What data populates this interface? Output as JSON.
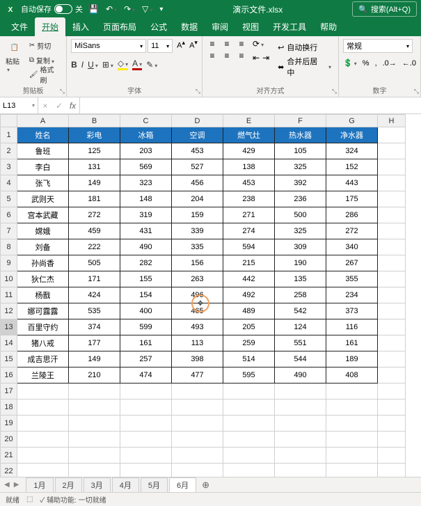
{
  "titlebar": {
    "autosave_label": "自动保存",
    "autosave_state": "关",
    "filename": "演示文件.xlsx",
    "search_placeholder": "搜索(Alt+Q)"
  },
  "tabs": {
    "items": [
      "文件",
      "开始",
      "插入",
      "页面布局",
      "公式",
      "数据",
      "审阅",
      "视图",
      "开发工具",
      "帮助"
    ],
    "active": "开始"
  },
  "ribbon": {
    "clipboard": {
      "paste": "粘贴",
      "cut": "剪切",
      "copy": "复制",
      "format_painter": "格式刷",
      "group_label": "剪贴板"
    },
    "font": {
      "name": "MiSans",
      "size": "11",
      "group_label": "字体"
    },
    "alignment": {
      "wrap": "自动换行",
      "merge": "合并后居中",
      "group_label": "对齐方式"
    },
    "number": {
      "format": "常规",
      "group_label": "数字"
    }
  },
  "namebox": {
    "cell": "L13"
  },
  "columns": [
    "A",
    "B",
    "C",
    "D",
    "E",
    "F",
    "G",
    "H"
  ],
  "header_row": [
    "姓名",
    "彩电",
    "冰箱",
    "空调",
    "燃气灶",
    "热水器",
    "净水器"
  ],
  "chart_data": {
    "type": "table",
    "title": "",
    "columns": [
      "姓名",
      "彩电",
      "冰箱",
      "空调",
      "燃气灶",
      "热水器",
      "净水器"
    ],
    "rows": [
      {
        "姓名": "鲁班",
        "彩电": 125,
        "冰箱": 203,
        "空调": 453,
        "燃气灶": 429,
        "热水器": 105,
        "净水器": 324
      },
      {
        "姓名": "李白",
        "彩电": 131,
        "冰箱": 569,
        "空调": 527,
        "燃气灶": 138,
        "热水器": 325,
        "净水器": 152
      },
      {
        "姓名": "张飞",
        "彩电": 149,
        "冰箱": 323,
        "空调": 456,
        "燃气灶": 453,
        "热水器": 392,
        "净水器": 443
      },
      {
        "姓名": "武则天",
        "彩电": 181,
        "冰箱": 148,
        "空调": 204,
        "燃气灶": 238,
        "热水器": 236,
        "净水器": 175
      },
      {
        "姓名": "宫本武藏",
        "彩电": 272,
        "冰箱": 319,
        "空调": 159,
        "燃气灶": 271,
        "热水器": 500,
        "净水器": 286
      },
      {
        "姓名": "嫦娥",
        "彩电": 459,
        "冰箱": 431,
        "空调": 339,
        "燃气灶": 274,
        "热水器": 325,
        "净水器": 272
      },
      {
        "姓名": "刘备",
        "彩电": 222,
        "冰箱": 490,
        "空调": 335,
        "燃气灶": 594,
        "热水器": 309,
        "净水器": 340
      },
      {
        "姓名": "孙尚香",
        "彩电": 505,
        "冰箱": 282,
        "空调": 156,
        "燃气灶": 215,
        "热水器": 190,
        "净水器": 267
      },
      {
        "姓名": "狄仁杰",
        "彩电": 171,
        "冰箱": 155,
        "空调": 263,
        "燃气灶": 442,
        "热水器": 135,
        "净水器": 355
      },
      {
        "姓名": "杨戬",
        "彩电": 424,
        "冰箱": 154,
        "空调": 496,
        "燃气灶": 492,
        "热水器": 258,
        "净水器": 234
      },
      {
        "姓名": "娜可露露",
        "彩电": 535,
        "冰箱": 400,
        "空调": 465,
        "燃气灶": 489,
        "热水器": 542,
        "净水器": 373
      },
      {
        "姓名": "百里守约",
        "彩电": 374,
        "冰箱": 599,
        "空调": 493,
        "燃气灶": 205,
        "热水器": 124,
        "净水器": 116
      },
      {
        "姓名": "猪八戒",
        "彩电": 177,
        "冰箱": 161,
        "空调": 113,
        "燃气灶": 259,
        "热水器": 551,
        "净水器": 161
      },
      {
        "姓名": "成吉思汗",
        "彩电": 149,
        "冰箱": 257,
        "空调": 398,
        "燃气灶": 514,
        "热水器": 544,
        "净水器": 189
      },
      {
        "姓名": "兰陵王",
        "彩电": 210,
        "冰箱": 474,
        "空调": 477,
        "燃气灶": 595,
        "热水器": 490,
        "净水器": 408
      }
    ]
  },
  "empty_rows": [
    17,
    18,
    19,
    20,
    21,
    22
  ],
  "selected_row": 13,
  "sheet_tabs": {
    "items": [
      "1月",
      "2月",
      "3月",
      "4月",
      "5月",
      "6月"
    ],
    "active": "6月"
  },
  "statusbar": {
    "ready": "就绪",
    "accessibility": "辅助功能: 一切就绪"
  }
}
